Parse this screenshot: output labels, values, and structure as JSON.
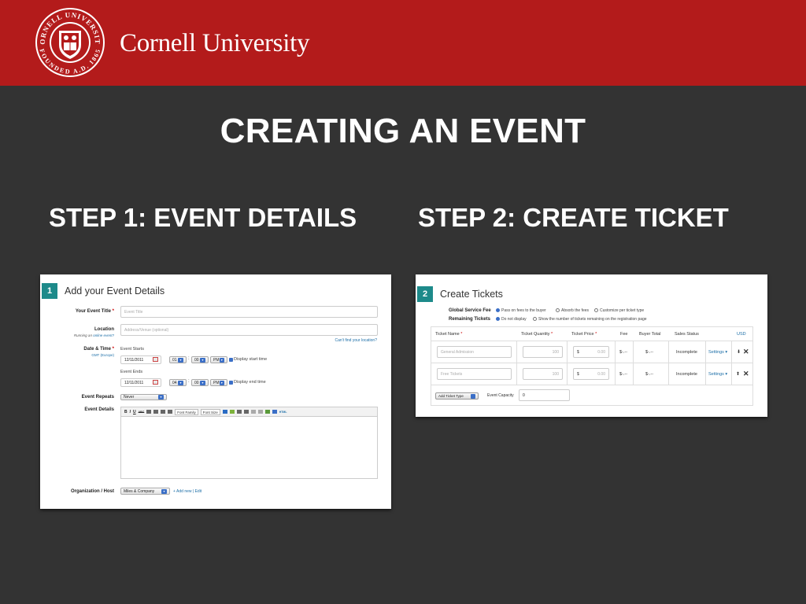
{
  "header": {
    "brand": "Cornell University",
    "seal_top_text": "CORNELL UNIVERSITY",
    "seal_bottom_text": "FOUNDED A.D. 1865",
    "color": "#b31b1b"
  },
  "slide": {
    "title": "CREATING AN EVENT",
    "step1": "STEP 1: EVENT DETAILS",
    "step2": "STEP 2: CREATE TICKET"
  },
  "event_details": {
    "number": "1",
    "title": "Add your Event Details",
    "event_title_label": "Your Event Title",
    "event_title_placeholder": "Event Title",
    "location_label": "Location",
    "location_sub_prefix": "Running an",
    "location_sub_link": "online event?",
    "location_placeholder": "Address/Venue (optional)",
    "cant_find_location": "Can't find your location?",
    "date_time_label": "Date & Time",
    "timezone_link": "GMT (Europe)",
    "event_starts": "Event Starts",
    "start_date": "12/11/2011",
    "start_hour": "01",
    "start_minute": "00",
    "start_ampm": "PM",
    "display_start_time": "Display start time",
    "event_ends": "Event Ends",
    "end_date": "12/11/2011",
    "end_hour": "04",
    "end_minute": "00",
    "end_ampm": "PM",
    "display_end_time": "Display end time",
    "event_repeats_label": "Event Repeats",
    "event_repeats_value": "Never",
    "event_details_label": "Event Details",
    "toolbar": {
      "bold": "B",
      "italic": "I",
      "underline": "U",
      "strike": "ABC",
      "font_family": "Font Family",
      "font_size": "Font Size",
      "html": "HTML"
    },
    "org_label": "Organization / Host",
    "org_value": "Miles & Company",
    "add_new": "+ Add new",
    "edit": "Edit"
  },
  "create_tickets": {
    "number": "2",
    "title": "Create Tickets",
    "global_fee_label": "Global Service Fee",
    "fee_options": [
      "Pass on fees to the buyer",
      "Absorb the fees",
      "Customize per ticket type"
    ],
    "remaining_label": "Remaining Tickets",
    "remaining_options": [
      "Do not display",
      "Show the number of tickets remaining on the registration page"
    ],
    "columns": {
      "name": "Ticket Name",
      "quantity": "Ticket Quantity",
      "price": "Ticket Price",
      "fee": "Fee",
      "buyer_total": "Buyer Total",
      "sales_status": "Sales Status",
      "currency": "USD"
    },
    "rows": [
      {
        "name_placeholder": "General Admission",
        "quantity": "100",
        "currency": "$",
        "price": "0.00",
        "fee": "$-.--",
        "total": "$-.--",
        "status": "Incomplete",
        "settings": "Settings"
      },
      {
        "name_placeholder": "Free Tickets",
        "quantity": "100",
        "currency": "$",
        "price": "0.00",
        "fee": "$-.--",
        "total": "$-.--",
        "status": "Incomplete",
        "settings": "Settings"
      }
    ],
    "add_ticket_type": "Add Ticket Type",
    "event_capacity_label": "Event Capacity",
    "event_capacity_value": "0"
  }
}
